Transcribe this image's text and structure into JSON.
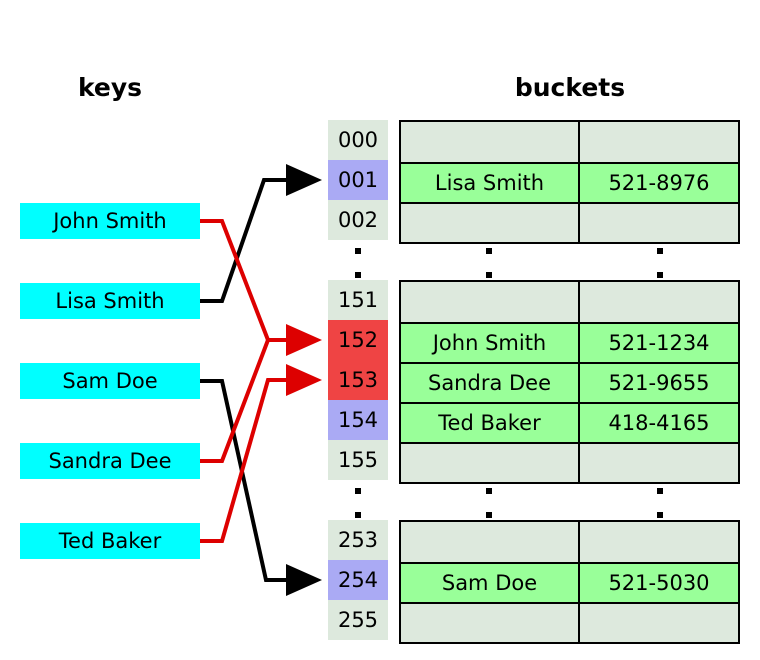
{
  "headings": {
    "keys": "keys",
    "buckets": "buckets"
  },
  "colors": {
    "key_box": "#00ffff",
    "index_default": "#dde9dd",
    "index_highlight_blue": "#aaaaf4",
    "index_collision_red": "#ef4444",
    "bucket_empty": "#dde9dd",
    "bucket_filled": "#99ff99",
    "wire_black": "#000000",
    "wire_red": "#dd0000",
    "border": "#000000"
  },
  "keys": [
    {
      "label": "John Smith"
    },
    {
      "label": "Lisa Smith"
    },
    {
      "label": "Sam Doe"
    },
    {
      "label": "Sandra Dee"
    },
    {
      "label": "Ted Baker"
    }
  ],
  "buckets": {
    "groups": [
      {
        "rows": [
          {
            "index": "000",
            "index_state": "default",
            "name": "",
            "phone": "",
            "filled": false
          },
          {
            "index": "001",
            "index_state": "blue",
            "name": "Lisa Smith",
            "phone": "521-8976",
            "filled": true
          },
          {
            "index": "002",
            "index_state": "default",
            "name": "",
            "phone": "",
            "filled": false
          }
        ]
      },
      {
        "rows": [
          {
            "index": "151",
            "index_state": "default",
            "name": "",
            "phone": "",
            "filled": false
          },
          {
            "index": "152",
            "index_state": "red",
            "name": "John Smith",
            "phone": "521-1234",
            "filled": true
          },
          {
            "index": "153",
            "index_state": "red",
            "name": "Sandra Dee",
            "phone": "521-9655",
            "filled": true
          },
          {
            "index": "154",
            "index_state": "blue",
            "name": "Ted Baker",
            "phone": "418-4165",
            "filled": true
          },
          {
            "index": "155",
            "index_state": "default",
            "name": "",
            "phone": "",
            "filled": false
          }
        ]
      },
      {
        "rows": [
          {
            "index": "253",
            "index_state": "default",
            "name": "",
            "phone": "",
            "filled": false
          },
          {
            "index": "254",
            "index_state": "blue",
            "name": "Sam Doe",
            "phone": "521-5030",
            "filled": true
          },
          {
            "index": "255",
            "index_state": "default",
            "name": "",
            "phone": "",
            "filled": false
          }
        ]
      }
    ]
  },
  "mappings": [
    {
      "from": "John Smith",
      "to": "152",
      "wire": "red"
    },
    {
      "from": "Lisa Smith",
      "to": "001",
      "wire": "black"
    },
    {
      "from": "Sam Doe",
      "to": "254",
      "wire": "black"
    },
    {
      "from": "Sandra Dee",
      "to": "152",
      "wire": "red"
    },
    {
      "from": "Ted Baker",
      "to": "153",
      "wire": "red"
    }
  ],
  "ellipsis": {
    "glyph": "vertical-ellipsis",
    "count": 6
  }
}
